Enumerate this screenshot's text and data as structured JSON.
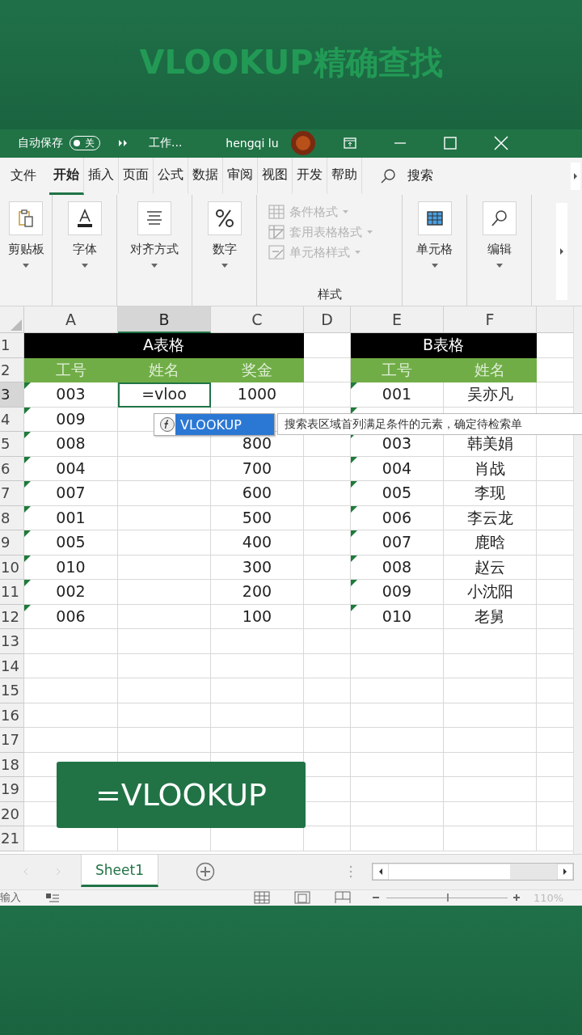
{
  "video_title": "VLOOKUP精确查找",
  "title_bar": {
    "autosave_label": "自动保存",
    "autosave_toggle": {
      "label": "关",
      "on": false
    },
    "document": "工作...",
    "user": "hengqi lu"
  },
  "menu_tabs": [
    {
      "label": "文件",
      "selected": false
    },
    {
      "label": "开始",
      "selected": true
    },
    {
      "label": "插入",
      "selected": false
    },
    {
      "label": "页面",
      "selected": false
    },
    {
      "label": "公式",
      "selected": false
    },
    {
      "label": "数据",
      "selected": false
    },
    {
      "label": "审阅",
      "selected": false
    },
    {
      "label": "视图",
      "selected": false
    },
    {
      "label": "开发",
      "selected": false
    },
    {
      "label": "帮助",
      "selected": false
    }
  ],
  "search": {
    "label": "搜索"
  },
  "ribbon": {
    "groups": [
      {
        "kind": "big",
        "label": "剪贴板"
      },
      {
        "kind": "big",
        "label": "字体"
      },
      {
        "kind": "big",
        "label": "对齐方式"
      },
      {
        "kind": "big",
        "label": "数字"
      },
      {
        "kind": "list",
        "label": "样式",
        "items": [
          {
            "label": "条件格式",
            "disabled": true
          },
          {
            "label": "套用表格格式",
            "disabled": true
          },
          {
            "label": "单元格样式",
            "disabled": true
          }
        ]
      },
      {
        "kind": "big",
        "label": "单元格"
      },
      {
        "kind": "big",
        "label": "编辑"
      }
    ]
  },
  "sheet": {
    "columns": [
      {
        "label": "A",
        "selected": false
      },
      {
        "label": "B",
        "selected": true
      },
      {
        "label": "C",
        "selected": false
      },
      {
        "label": "D",
        "selected": false
      },
      {
        "label": "E",
        "selected": false
      },
      {
        "label": "F",
        "selected": false
      }
    ],
    "rows": [
      {
        "number": "1",
        "kind": "title",
        "selected": false,
        "flagged": false,
        "cells": {
          "A": "A表格",
          "E": "B表格"
        }
      },
      {
        "number": "2",
        "kind": "header",
        "selected": false,
        "flagged": false,
        "cells": {
          "A": "工号",
          "B": "姓名",
          "C": "奖金",
          "E": "工号",
          "F": "姓名"
        }
      },
      {
        "number": "3",
        "kind": "data",
        "selected": true,
        "flagged": true,
        "cells": {
          "A": "003",
          "B": "=vloo",
          "C": "1000",
          "E": "001",
          "F": "吴亦凡"
        }
      },
      {
        "number": "4",
        "kind": "data",
        "selected": false,
        "flagged": true,
        "cells": {
          "A": "009"
        }
      },
      {
        "number": "5",
        "kind": "data",
        "selected": false,
        "flagged": true,
        "cells": {
          "A": "008",
          "C": "800",
          "E": "003",
          "F": "韩美娟"
        }
      },
      {
        "number": "6",
        "kind": "data",
        "selected": false,
        "flagged": true,
        "cells": {
          "A": "004",
          "C": "700",
          "E": "004",
          "F": "肖战"
        }
      },
      {
        "number": "7",
        "kind": "data",
        "selected": false,
        "flagged": true,
        "cells": {
          "A": "007",
          "C": "600",
          "E": "005",
          "F": "李现"
        }
      },
      {
        "number": "8",
        "kind": "data",
        "selected": false,
        "flagged": true,
        "cells": {
          "A": "001",
          "C": "500",
          "E": "006",
          "F": "李云龙"
        }
      },
      {
        "number": "9",
        "kind": "data",
        "selected": false,
        "flagged": true,
        "cells": {
          "A": "005",
          "C": "400",
          "E": "007",
          "F": "鹿晗"
        }
      },
      {
        "number": "10",
        "kind": "data",
        "selected": false,
        "flagged": true,
        "cells": {
          "A": "010",
          "C": "300",
          "E": "008",
          "F": "赵云"
        }
      },
      {
        "number": "11",
        "kind": "data",
        "selected": false,
        "flagged": true,
        "cells": {
          "A": "002",
          "C": "200",
          "E": "009",
          "F": "小沈阳"
        }
      },
      {
        "number": "12",
        "kind": "data",
        "selected": false,
        "flagged": true,
        "cells": {
          "A": "006",
          "C": "100",
          "E": "010",
          "F": "老舅"
        }
      },
      {
        "number": "13",
        "kind": "data",
        "selected": false,
        "flagged": false,
        "cells": {}
      },
      {
        "number": "14",
        "kind": "data",
        "selected": false,
        "flagged": false,
        "cells": {}
      },
      {
        "number": "15",
        "kind": "data",
        "selected": false,
        "flagged": false,
        "cells": {}
      },
      {
        "number": "16",
        "kind": "data",
        "selected": false,
        "flagged": false,
        "cells": {}
      },
      {
        "number": "17",
        "kind": "data",
        "selected": false,
        "flagged": false,
        "cells": {}
      },
      {
        "number": "18",
        "kind": "data",
        "selected": false,
        "flagged": false,
        "cells": {}
      },
      {
        "number": "19",
        "kind": "data",
        "selected": false,
        "flagged": false,
        "cells": {}
      },
      {
        "number": "20",
        "kind": "data",
        "selected": false,
        "flagged": false,
        "cells": {}
      },
      {
        "number": "21",
        "kind": "data",
        "selected": false,
        "flagged": false,
        "cells": {}
      }
    ],
    "autocomplete": {
      "items": [
        {
          "label": "VLOOKUP",
          "selected": true
        }
      ],
      "tooltip": "搜索表区域首列满足条件的元素，确定待检索单"
    },
    "caption": "=VLOOKUP"
  },
  "sheet_tabs": [
    {
      "label": "Sheet1",
      "selected": true
    }
  ],
  "status_bar": {
    "mode": "输入",
    "zoom": {
      "level": 0.5,
      "reading": "110%"
    }
  }
}
